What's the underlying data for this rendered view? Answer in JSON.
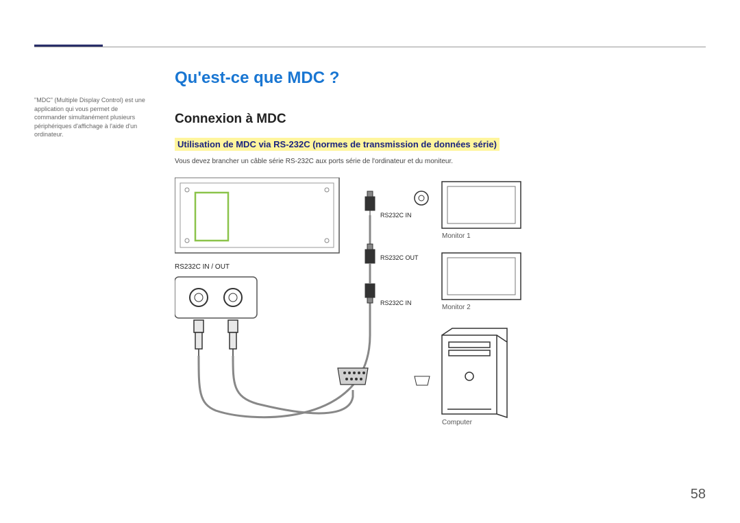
{
  "sidebar": {
    "note": "\"MDC\" (Multiple Display Control) est une application qui vous permet de commander simultanément plusieurs périphériques d'affichage à l'aide d'un ordinateur."
  },
  "content": {
    "title": "Qu'est-ce que MDC ?",
    "section": "Connexion à MDC",
    "subsection": "Utilisation de MDC via RS-232C (normes de transmission de données série)",
    "body": "Vous devez brancher un câble série RS-232C aux ports série de l'ordinateur et du moniteur."
  },
  "diagram": {
    "port_panel_label": "RS232C IN / OUT",
    "conn1": "RS232C IN",
    "conn2": "RS232C OUT",
    "conn3": "RS232C IN",
    "monitor1": "Monitor 1",
    "monitor2": "Monitor 2",
    "computer": "Computer"
  },
  "page_number": "58"
}
